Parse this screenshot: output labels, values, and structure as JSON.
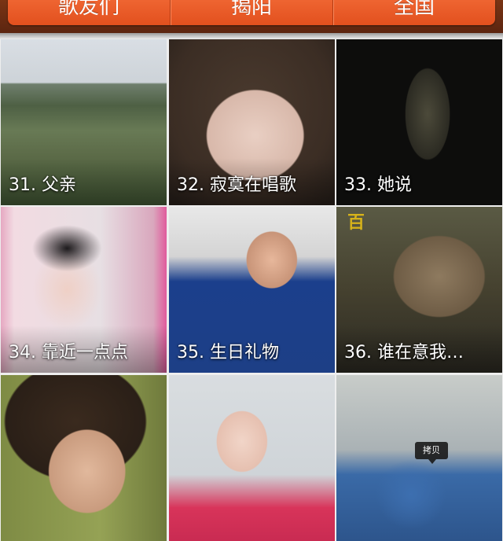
{
  "tabbar": {
    "tabs": [
      {
        "label": "歌友们"
      },
      {
        "label": "揭阳"
      },
      {
        "label": "全国"
      }
    ]
  },
  "grid": {
    "items": [
      {
        "caption": "31. 父亲"
      },
      {
        "caption": "32. 寂寞在唱歌"
      },
      {
        "caption": "33. 她说"
      },
      {
        "caption": "34. 靠近一点点"
      },
      {
        "caption": "35. 生日礼物"
      },
      {
        "caption": "36. 谁在意我…"
      },
      {
        "caption": ""
      },
      {
        "caption": ""
      },
      {
        "caption": "",
        "overlay_tag": "拷贝"
      }
    ]
  },
  "photo_overlay_text": "百"
}
